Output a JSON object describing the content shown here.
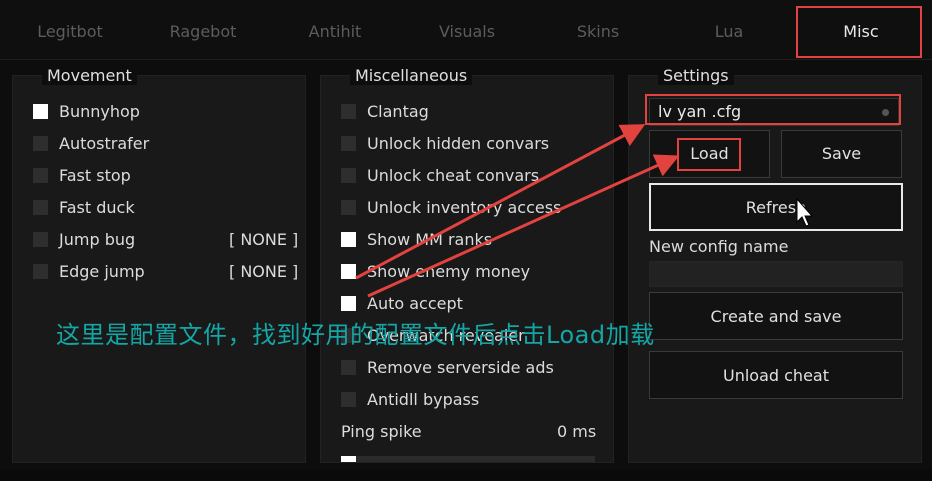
{
  "tabs": [
    {
      "label": "Legitbot"
    },
    {
      "label": "Ragebot"
    },
    {
      "label": "Antihit"
    },
    {
      "label": "Visuals"
    },
    {
      "label": "Skins"
    },
    {
      "label": "Lua"
    },
    {
      "label": "Misc"
    }
  ],
  "movement": {
    "title": "Movement",
    "items": [
      {
        "label": "Bunnyhop",
        "checked": true,
        "key": ""
      },
      {
        "label": "Autostrafer",
        "checked": false,
        "key": ""
      },
      {
        "label": "Fast stop",
        "checked": false,
        "key": ""
      },
      {
        "label": "Fast duck",
        "checked": false,
        "key": ""
      },
      {
        "label": "Jump bug",
        "checked": false,
        "key": "[ NONE ]"
      },
      {
        "label": "Edge jump",
        "checked": false,
        "key": "[ NONE ]"
      }
    ]
  },
  "misc": {
    "title": "Miscellaneous",
    "items": [
      {
        "label": "Clantag",
        "checked": false
      },
      {
        "label": "Unlock hidden convars",
        "checked": false
      },
      {
        "label": "Unlock cheat convars",
        "checked": false
      },
      {
        "label": "Unlock inventory access",
        "checked": false
      },
      {
        "label": "Show MM ranks",
        "checked": true
      },
      {
        "label": "Show enemy money",
        "checked": true
      },
      {
        "label": "Auto accept",
        "checked": true
      },
      {
        "label": "Overwatch revealer",
        "checked": false
      },
      {
        "label": "Remove serverside ads",
        "checked": false
      },
      {
        "label": "Antidll bypass",
        "checked": false
      }
    ],
    "ping_spike": {
      "label": "Ping spike",
      "value_text": "0 ms",
      "value": 0
    }
  },
  "settings": {
    "title": "Settings",
    "config_selected": "lv yan .cfg",
    "load_label": "Load",
    "save_label": "Save",
    "refresh_label": "Refresh",
    "new_config_label": "New config name",
    "new_config_value": "",
    "create_label": "Create and save",
    "unload_label": "Unload cheat"
  },
  "annotation": {
    "text": "这里是配置文件，找到好用的配置文件后点击Load加载",
    "color": "#14a6a6"
  },
  "colors": {
    "highlight": "#e2433f",
    "checkbox_on": "#ffffff",
    "checkbox_off": "#2e2e2e"
  }
}
